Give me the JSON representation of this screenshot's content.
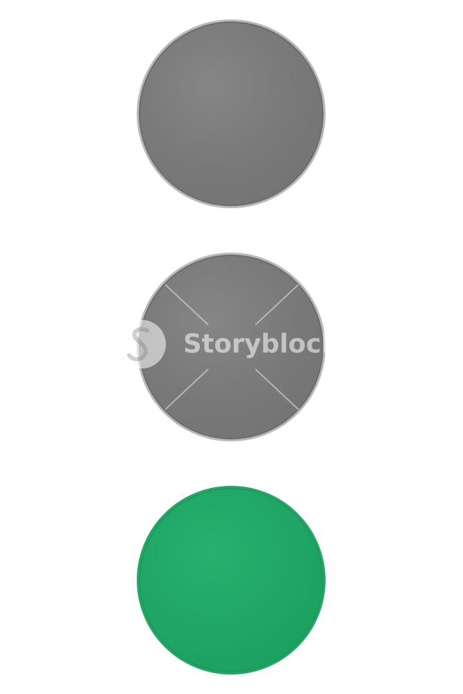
{
  "image": {
    "description_colors": {
      "background": "#ffffff",
      "lamp_off": "#7a7a7a",
      "lamp_on": "#1fa565"
    },
    "lamps": [
      {
        "state": "off",
        "color": "gray"
      },
      {
        "state": "off",
        "color": "gray"
      },
      {
        "state": "on",
        "color": "green"
      }
    ]
  },
  "watermark": {
    "text": "Storyblocks",
    "icon": "storyblocks-logo-icon"
  }
}
